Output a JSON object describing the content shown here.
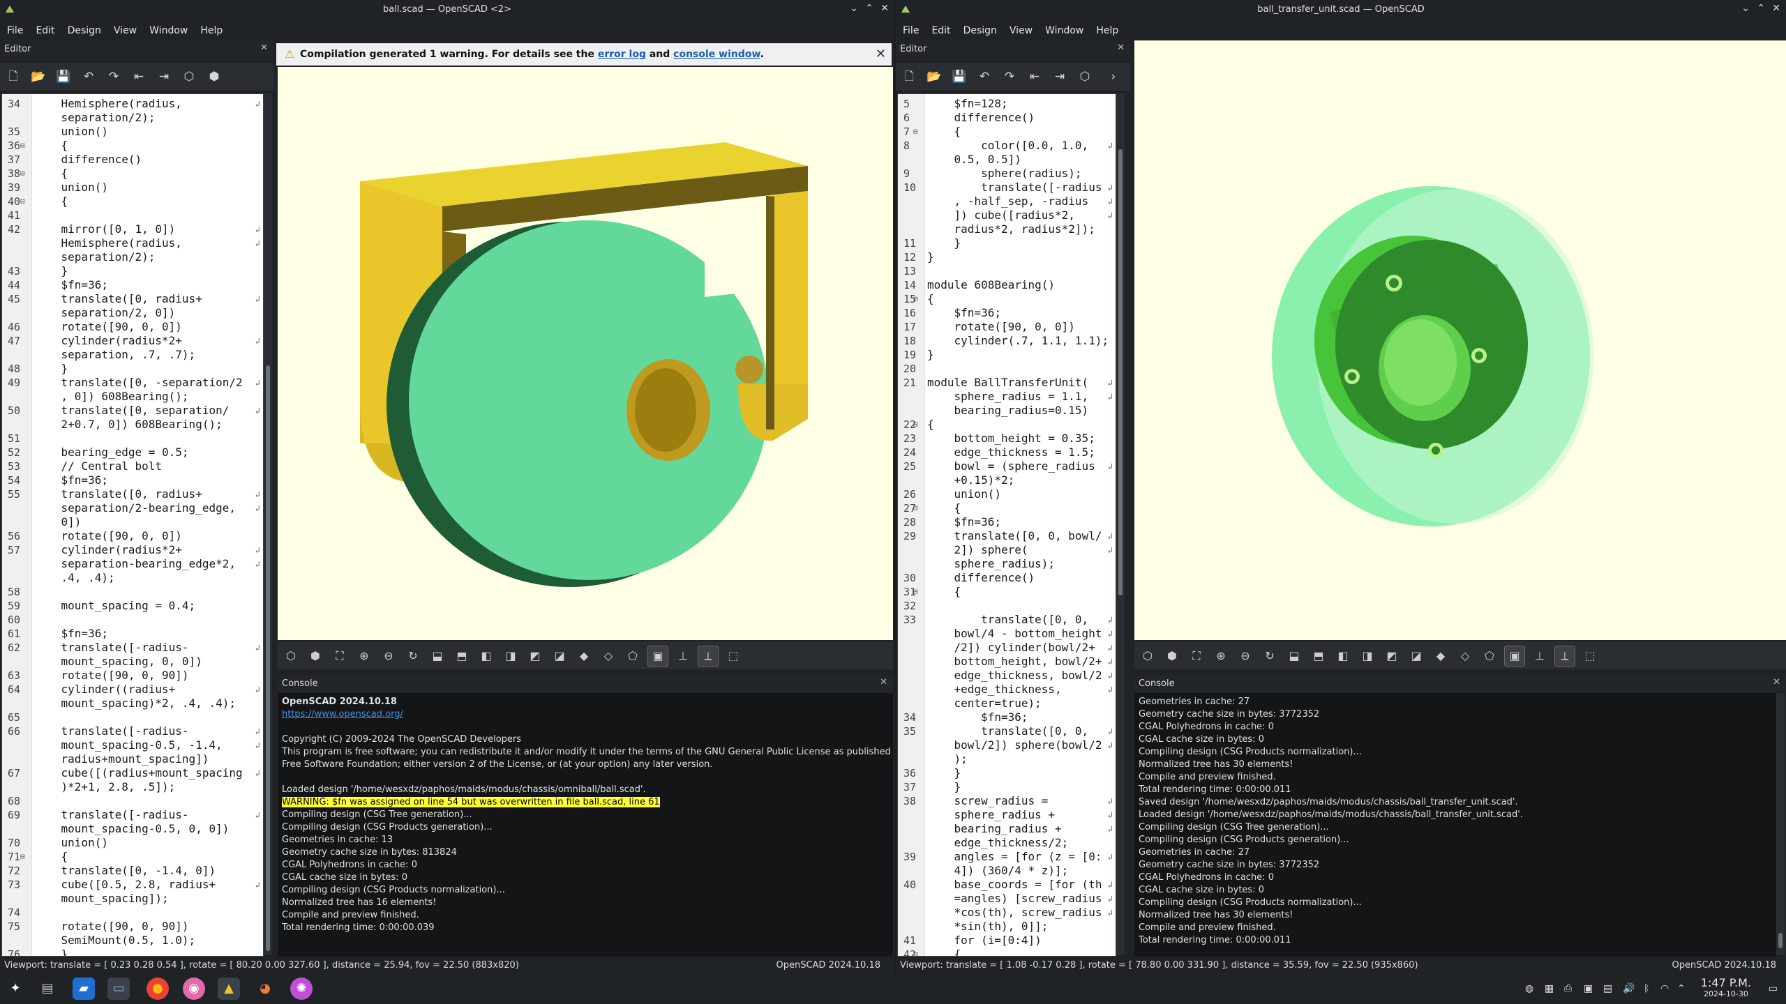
{
  "left_window": {
    "title": "ball.scad — OpenSCAD <2>",
    "menu": [
      "File",
      "Edit",
      "Design",
      "View",
      "Window",
      "Help"
    ],
    "editor_label": "Editor",
    "editor_lines": [
      {
        "n": "34",
        "t": "    Hemisphere(radius,",
        "wrap": true
      },
      {
        "n": "",
        "t": "    separation/2);"
      },
      {
        "n": "35",
        "t": "    union()"
      },
      {
        "n": "36",
        "t": "    {",
        "fold": true
      },
      {
        "n": "37",
        "t": "    difference()"
      },
      {
        "n": "38",
        "t": "    {",
        "fold": true
      },
      {
        "n": "39",
        "t": "    union()"
      },
      {
        "n": "40",
        "t": "    {",
        "fold": true
      },
      {
        "n": "41",
        "t": ""
      },
      {
        "n": "42",
        "t": "    mirror([0, 1, 0])",
        "wrap": true
      },
      {
        "n": "",
        "t": "    Hemisphere(radius,",
        "wrap": true
      },
      {
        "n": "",
        "t": "    separation/2);"
      },
      {
        "n": "43",
        "t": "    }"
      },
      {
        "n": "44",
        "t": "    $fn=36;"
      },
      {
        "n": "45",
        "t": "    translate([0, radius+",
        "wrap": true
      },
      {
        "n": "",
        "t": "    separation/2, 0])"
      },
      {
        "n": "46",
        "t": "    rotate([90, 0, 0])"
      },
      {
        "n": "47",
        "t": "    cylinder(radius*2+",
        "wrap": true
      },
      {
        "n": "",
        "t": "    separation, .7, .7);"
      },
      {
        "n": "48",
        "t": "    }"
      },
      {
        "n": "49",
        "t": "    translate([0, -separation/2",
        "wrap": true
      },
      {
        "n": "",
        "t": "    , 0]) 608Bearing();"
      },
      {
        "n": "50",
        "t": "    translate([0, separation/",
        "wrap": true
      },
      {
        "n": "",
        "t": "    2+0.7, 0]) 608Bearing();"
      },
      {
        "n": "51",
        "t": ""
      },
      {
        "n": "52",
        "t": "    bearing_edge = 0.5;"
      },
      {
        "n": "53",
        "t": "    // Central bolt",
        "cmt": true
      },
      {
        "n": "54",
        "t": "    $fn=36;"
      },
      {
        "n": "55",
        "t": "    translate([0, radius+",
        "wrap": true
      },
      {
        "n": "",
        "t": "    separation/2-bearing_edge,",
        "wrap": true
      },
      {
        "n": "",
        "t": "    0])"
      },
      {
        "n": "56",
        "t": "    rotate([90, 0, 0])"
      },
      {
        "n": "57",
        "t": "    cylinder(radius*2+",
        "wrap": true
      },
      {
        "n": "",
        "t": "    separation-bearing_edge*2,",
        "wrap": true
      },
      {
        "n": "",
        "t": "    .4, .4);"
      },
      {
        "n": "58",
        "t": ""
      },
      {
        "n": "59",
        "t": "    mount_spacing = 0.4;"
      },
      {
        "n": "60",
        "t": ""
      },
      {
        "n": "61",
        "t": "    $fn=36;"
      },
      {
        "n": "62",
        "t": "    translate([-radius-",
        "wrap": true
      },
      {
        "n": "",
        "t": "    mount_spacing, 0, 0])"
      },
      {
        "n": "63",
        "t": "    rotate([90, 0, 90])"
      },
      {
        "n": "64",
        "t": "    cylinder((radius+",
        "wrap": true
      },
      {
        "n": "",
        "t": "    mount_spacing)*2, .4, .4);"
      },
      {
        "n": "65",
        "t": ""
      },
      {
        "n": "66",
        "t": "    translate([-radius-",
        "wrap": true
      },
      {
        "n": "",
        "t": "    mount_spacing-0.5, -1.4,",
        "wrap": true
      },
      {
        "n": "",
        "t": "    radius+mount_spacing])"
      },
      {
        "n": "67",
        "t": "    cube([(radius+mount_spacing",
        "wrap": true
      },
      {
        "n": "",
        "t": "    )*2+1, 2.8, .5]);"
      },
      {
        "n": "68",
        "t": ""
      },
      {
        "n": "69",
        "t": "    translate([-radius-",
        "wrap": true
      },
      {
        "n": "",
        "t": "    mount_spacing-0.5, 0, 0])"
      },
      {
        "n": "70",
        "t": "    union()"
      },
      {
        "n": "71",
        "t": "    {",
        "fold": true
      },
      {
        "n": "72",
        "t": "    translate([0, -1.4, 0])"
      },
      {
        "n": "73",
        "t": "    cube([0.5, 2.8, radius+",
        "wrap": true
      },
      {
        "n": "",
        "t": "    mount_spacing]);"
      },
      {
        "n": "74",
        "t": ""
      },
      {
        "n": "75",
        "t": "    rotate([90, 0, 90])"
      },
      {
        "n": "",
        "t": "    SemiMount(0.5, 1.0);"
      },
      {
        "n": "76",
        "t": "    }"
      }
    ],
    "warning_prefix": "Compilation generated 1 warning. For details see the",
    "warning_link1": "error log",
    "warning_and": "and",
    "warning_link2": "console window",
    "warning_suffix": ".",
    "console_label": "Console",
    "console_lines": [
      {
        "t": "OpenSCAD 2024.10.18",
        "style": "bold"
      },
      {
        "t": "https://www.openscad.org/",
        "style": "link"
      },
      {
        "t": ""
      },
      {
        "t": "Copyright (C) 2009-2024 The OpenSCAD Developers"
      },
      {
        "t": "This program is free software; you can redistribute it and/or modify it under the terms of the GNU General Public License as published by the"
      },
      {
        "t": "Free Software Foundation; either version 2 of the License, or (at your option) any later version."
      },
      {
        "t": ""
      },
      {
        "t": "Loaded design '/home/wesxdz/paphos/maids/modus/chassis/omniball/ball.scad'."
      },
      {
        "t": "WARNING: $fn was assigned on line 54 but was overwritten in file ball.scad, line 61",
        "style": "warn"
      },
      {
        "t": "Compiling design (CSG Tree generation)..."
      },
      {
        "t": "Compiling design (CSG Products generation)..."
      },
      {
        "t": "Geometries in cache: 13"
      },
      {
        "t": "Geometry cache size in bytes: 813824"
      },
      {
        "t": "CGAL Polyhedrons in cache: 0"
      },
      {
        "t": "CGAL cache size in bytes: 0"
      },
      {
        "t": "Compiling design (CSG Products normalization)..."
      },
      {
        "t": "Normalized tree has 16 elements!"
      },
      {
        "t": "Compile and preview finished."
      },
      {
        "t": "Total rendering time: 0:00:00.039"
      }
    ],
    "status_left": "Viewport: translate = [ 0.23 0.28 0.54 ], rotate = [ 80.20 0.00 327.60 ], distance = 25.94, fov = 22.50 (883x820)",
    "status_right": "OpenSCAD 2024.10.18"
  },
  "right_window": {
    "title": "ball_transfer_unit.scad — OpenSCAD",
    "menu": [
      "File",
      "Edit",
      "Design",
      "View",
      "Window",
      "Help"
    ],
    "editor_label": "Editor",
    "editor_lines": [
      {
        "n": "5",
        "t": "    $fn=128;"
      },
      {
        "n": "6",
        "t": "    difference()"
      },
      {
        "n": "7",
        "t": "    {",
        "fold": true
      },
      {
        "n": "8",
        "t": "        color([0.0, 1.0,",
        "wrap": true
      },
      {
        "n": "",
        "t": "    0.5, 0.5])"
      },
      {
        "n": "9",
        "t": "        sphere(radius);"
      },
      {
        "n": "10",
        "t": "        translate([-radius",
        "wrap": true
      },
      {
        "n": "",
        "t": "    , -half_sep, -radius",
        "wrap": true
      },
      {
        "n": "",
        "t": "    ]) cube([radius*2,",
        "wrap": true
      },
      {
        "n": "",
        "t": "    radius*2, radius*2]);"
      },
      {
        "n": "11",
        "t": "    }"
      },
      {
        "n": "12",
        "t": "}"
      },
      {
        "n": "13",
        "t": ""
      },
      {
        "n": "14",
        "t": "module 608Bearing()"
      },
      {
        "n": "15",
        "t": "{",
        "fold": true
      },
      {
        "n": "16",
        "t": "    $fn=36;"
      },
      {
        "n": "17",
        "t": "    rotate([90, 0, 0])"
      },
      {
        "n": "18",
        "t": "    cylinder(.7, 1.1, 1.1);"
      },
      {
        "n": "19",
        "t": "}"
      },
      {
        "n": "20",
        "t": ""
      },
      {
        "n": "21",
        "t": "module BallTransferUnit(",
        "wrap": true
      },
      {
        "n": "",
        "t": "    sphere_radius = 1.1,",
        "wrap": true
      },
      {
        "n": "",
        "t": "    bearing_radius=0.15)"
      },
      {
        "n": "22",
        "t": "{",
        "fold": true
      },
      {
        "n": "23",
        "t": "    bottom_height = 0.35;"
      },
      {
        "n": "24",
        "t": "    edge_thickness = 1.5;"
      },
      {
        "n": "25",
        "t": "    bowl = (sphere_radius",
        "wrap": true
      },
      {
        "n": "",
        "t": "    +0.15)*2;"
      },
      {
        "n": "26",
        "t": "    union()"
      },
      {
        "n": "27",
        "t": "    {",
        "fold": true
      },
      {
        "n": "28",
        "t": "    $fn=36;"
      },
      {
        "n": "29",
        "t": "    translate([0, 0, bowl/",
        "wrap": true
      },
      {
        "n": "",
        "t": "    2]) sphere(",
        "wrap": true
      },
      {
        "n": "",
        "t": "    sphere_radius);"
      },
      {
        "n": "30",
        "t": "    difference()"
      },
      {
        "n": "31",
        "t": "    {",
        "fold": true
      },
      {
        "n": "32",
        "t": ""
      },
      {
        "n": "33",
        "t": "        translate([0, 0,",
        "wrap": true
      },
      {
        "n": "",
        "t": "    bowl/4 - bottom_height",
        "wrap": true
      },
      {
        "n": "",
        "t": "    /2]) cylinder(bowl/2+",
        "wrap": true
      },
      {
        "n": "",
        "t": "    bottom_height, bowl/2+",
        "wrap": true
      },
      {
        "n": "",
        "t": "    edge_thickness, bowl/2",
        "wrap": true
      },
      {
        "n": "",
        "t": "    +edge_thickness,",
        "wrap": true
      },
      {
        "n": "",
        "t": "    center=true);"
      },
      {
        "n": "34",
        "t": "        $fn=36;"
      },
      {
        "n": "35",
        "t": "        translate([0, 0,",
        "wrap": true
      },
      {
        "n": "",
        "t": "    bowl/2]) sphere(bowl/2",
        "wrap": true
      },
      {
        "n": "",
        "t": "    );"
      },
      {
        "n": "36",
        "t": "    }"
      },
      {
        "n": "37",
        "t": "    }"
      },
      {
        "n": "38",
        "t": "    screw_radius =",
        "wrap": true
      },
      {
        "n": "",
        "t": "    sphere_radius +",
        "wrap": true
      },
      {
        "n": "",
        "t": "    bearing_radius +",
        "wrap": true
      },
      {
        "n": "",
        "t": "    edge_thickness/2;"
      },
      {
        "n": "39",
        "t": "    angles = [for (z = [0:",
        "wrap": true
      },
      {
        "n": "",
        "t": "    4]) (360/4 * z)];"
      },
      {
        "n": "40",
        "t": "    base_coords = [for (th",
        "wrap": true
      },
      {
        "n": "",
        "t": "    =angles) [screw_radius",
        "wrap": true
      },
      {
        "n": "",
        "t": "    *cos(th), screw_radius",
        "wrap": true
      },
      {
        "n": "",
        "t": "    *sin(th), 0]];"
      },
      {
        "n": "41",
        "t": "    for (i=[0:4])"
      },
      {
        "n": "42",
        "t": "    {",
        "fold": true
      }
    ],
    "console_label": "Console",
    "console_lines": [
      {
        "t": "Geometries in cache: 27"
      },
      {
        "t": "Geometry cache size in bytes: 3772352"
      },
      {
        "t": "CGAL Polyhedrons in cache: 0"
      },
      {
        "t": "CGAL cache size in bytes: 0"
      },
      {
        "t": "Compiling design (CSG Products normalization)..."
      },
      {
        "t": "Normalized tree has 30 elements!"
      },
      {
        "t": "Compile and preview finished."
      },
      {
        "t": "Total rendering time: 0:00:00.011"
      },
      {
        "t": "Saved design '/home/wesxdz/paphos/maids/modus/chassis/ball_transfer_unit.scad'."
      },
      {
        "t": "Loaded design '/home/wesxdz/paphos/maids/modus/chassis/ball_transfer_unit.scad'."
      },
      {
        "t": "Compiling design (CSG Tree generation)..."
      },
      {
        "t": "Compiling design (CSG Products generation)..."
      },
      {
        "t": "Geometries in cache: 27"
      },
      {
        "t": "Geometry cache size in bytes: 3772352"
      },
      {
        "t": "CGAL Polyhedrons in cache: 0"
      },
      {
        "t": "CGAL cache size in bytes: 0"
      },
      {
        "t": "Compiling design (CSG Products normalization)..."
      },
      {
        "t": "Normalized tree has 30 elements!"
      },
      {
        "t": "Compile and preview finished."
      },
      {
        "t": "Total rendering time: 0:00:00.011"
      }
    ],
    "status_left": "Viewport: translate = [ 1.08 -0.17 0.28 ], rotate = [ 78.80 0.00 331.90 ], distance = 35.59, fov = 22.50 (935x860)",
    "status_right": "OpenSCAD 2024.10.18"
  },
  "taskbar": {
    "apps": [
      "app-launcher-icon",
      "task-manager-icon",
      "file-manager-icon",
      "dolphin-icon",
      "chrome-icon",
      "pink-app-icon",
      "openscad-icon",
      "blender-icon",
      "color-app-icon"
    ],
    "time": "1:47 P.M.",
    "date": "2024-10-30"
  },
  "colors": {
    "viewport_bg": "#ffffe5",
    "model_yellow": "#e8c52a",
    "ball_green": "#5fdb9a",
    "warning_highlight": "#ffff33"
  }
}
